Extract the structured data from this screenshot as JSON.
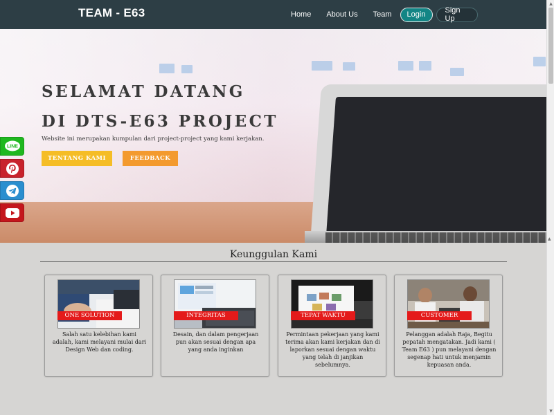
{
  "navbar": {
    "brand": "TEAM - E63",
    "links": [
      "Home",
      "About Us",
      "Team"
    ],
    "login": "Login",
    "signup": "Sign Up"
  },
  "hero": {
    "title_line1": "SELAMAT DATANG",
    "title_line2": "DI DTS-E63 PROJECT",
    "description": "Website ini merupakan kumpulan dari project-project yang kami kerjakan.",
    "btn_tentang": "TENTANG KAMI",
    "btn_feedback": "FEEDBACK"
  },
  "social": [
    {
      "name": "line",
      "label": "LINE",
      "color": "#1fb81f"
    },
    {
      "name": "pinterest",
      "label": "",
      "color": "#c8232c"
    },
    {
      "name": "telegram",
      "label": "",
      "color": "#2a8ecf"
    },
    {
      "name": "youtube",
      "label": "",
      "color": "#c4161c"
    }
  ],
  "section": {
    "title": "Keunggulan Kami",
    "cards": [
      {
        "label": "ONE SOLUTION",
        "text": "Salah satu kelebihan kami adalah, kami melayani mulai dari Design Web dan coding."
      },
      {
        "label": "INTEGRITAS",
        "text": "Desain, dan dalam pengerjaan pun akan sesuai dengan apa yang anda inginkan"
      },
      {
        "label": "TEPAT WAKTU",
        "text": "Permintaan pekerjaan yang kami terima akan kami kerjakan dan di laporkan sesuai dengan waktu yang telah di janjikan sebelumnya."
      },
      {
        "label": "CUSTOMER",
        "text": "Pelanggan adalah Raja, Begitu pepatah mengatakan. Jadi kami ( Team E63 ) pun melayani dengan segenap hati untuk menjamin kepuasan anda."
      }
    ]
  },
  "colors": {
    "navbar": "#2d3e45",
    "login": "#138585",
    "accent_yellow": "#f5bd26",
    "accent_orange": "#f39a2e",
    "card_label": "#e41a1a"
  }
}
